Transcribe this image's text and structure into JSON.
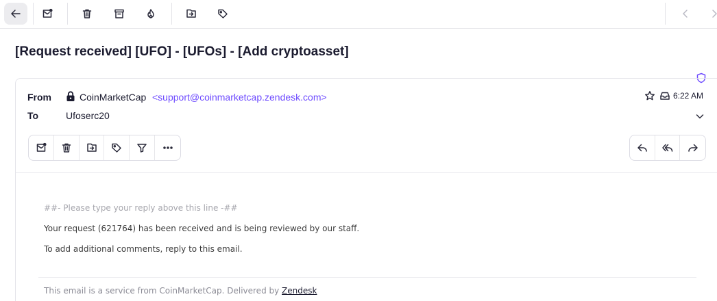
{
  "toolbar": {
    "icons": [
      "back-arrow-icon",
      "mark-unread-icon",
      "trash-icon",
      "archive-icon",
      "spam-flame-icon",
      "move-to-folder-icon",
      "label-tag-icon",
      "previous-chevron-icon",
      "next-chevron-icon"
    ]
  },
  "message": {
    "subject": "[Request received] [UFO] - [UFOs] - [Add cryptoasset]",
    "from_label": "From",
    "to_label": "To",
    "sender_name": "CoinMarketCap",
    "sender_email": "<support@coinmarketcap.zendesk.com>",
    "recipient": "Ufoserc20",
    "time": "6:22 AM"
  },
  "body": {
    "reply_line": "##- Please type your reply above this line -##",
    "line1": "Your request (621764) has been received and is being reviewed by our staff.",
    "line2": "To add additional comments, reply to this email.",
    "footer_prefix": "This email is a service from CoinMarketCap. Delivered by ",
    "footer_link": "Zendesk"
  },
  "colors": {
    "accent": "#6d4aff",
    "text": "#1b1b2f",
    "muted": "#a6a6ad"
  }
}
